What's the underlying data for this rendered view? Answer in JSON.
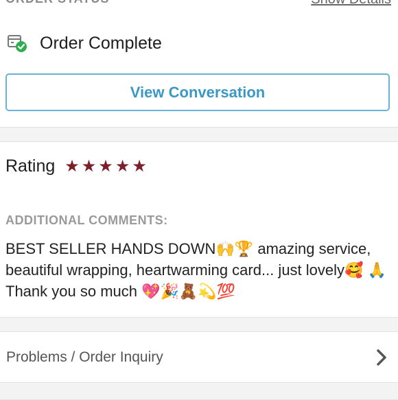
{
  "order_status": {
    "section_label": "ORDER STATUS",
    "details_link": "Show Details",
    "status_text": "Order Complete",
    "status_icon": "package-check-icon"
  },
  "actions": {
    "view_conversation": "View Conversation"
  },
  "rating": {
    "label": "Rating",
    "stars": 5,
    "star_color": "#7c1f2a"
  },
  "comments": {
    "label": "ADDITIONAL COMMENTS:",
    "text": "BEST SELLER HANDS DOWN🙌🏆 amazing service, beautiful wrapping, heartwarming card... just lovely🥰 🙏 Thank you so much 💖🎉🧸💫💯"
  },
  "inquiry": {
    "label": "Problems / Order Inquiry"
  },
  "colors": {
    "accent": "#3b97c4",
    "success": "#2fae4f"
  }
}
